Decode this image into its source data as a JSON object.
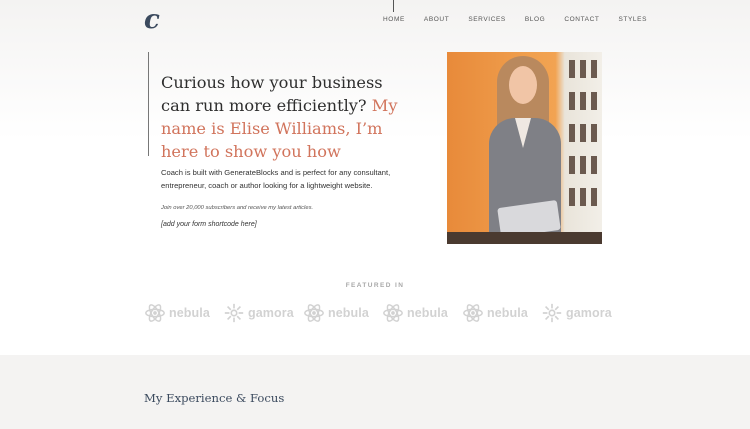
{
  "logo": {
    "letter": "c"
  },
  "nav": {
    "items": [
      {
        "label": "HOME"
      },
      {
        "label": "ABOUT"
      },
      {
        "label": "SERVICES"
      },
      {
        "label": "BLOG"
      },
      {
        "label": "CONTACT"
      },
      {
        "label": "STYLES"
      }
    ]
  },
  "hero": {
    "title_plain": "Curious how your business can run more efficiently?",
    "title_accent": "My name is Elise Williams, I’m here to show you how",
    "body": "Coach is built with GenerateBlocks and is perfect for any consultant, entrepreneur, coach or author looking for a lightweight website.",
    "note": "Join over 20,000 subscribers and receive my latest articles.",
    "shortcode": "[add your form shortcode here]"
  },
  "featured": {
    "label": "FEATURED IN",
    "logos": [
      {
        "name": "nebula",
        "icon": "atom-icon"
      },
      {
        "name": "gamora",
        "icon": "flower-icon"
      },
      {
        "name": "nebula",
        "icon": "atom-icon"
      },
      {
        "name": "nebula",
        "icon": "atom-icon"
      },
      {
        "name": "nebula",
        "icon": "atom-icon"
      },
      {
        "name": "gamora",
        "icon": "flower-icon"
      }
    ]
  },
  "section": {
    "title": "My Experience & Focus"
  },
  "colors": {
    "accent": "#d1745c",
    "heading": "#3b4a5e",
    "logo_gray": "#d2d2d2"
  }
}
